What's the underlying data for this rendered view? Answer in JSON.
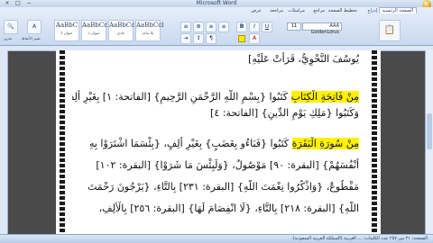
{
  "window": {
    "title": "Microsoft Word",
    "doc_title": "المتخصصة الأولى (مرتبة) - ...",
    "min": "−",
    "max": "□",
    "close": "×"
  },
  "tabs": [
    "الصفحة الرئيسية",
    "إدراج",
    "تخطيط الصفحة",
    "مراجع",
    "مراسلات",
    "مراجعة",
    "عرض"
  ],
  "ribbon": {
    "styles": [
      {
        "preview": "AaBbC",
        "label": "عنوان 1"
      },
      {
        "preview": "AaBbCcI",
        "label": "عنوان 2"
      },
      {
        "preview": "AaBbCcI",
        "label": "عادي"
      },
      {
        "preview": "AaBbCcl",
        "label": "بلا تباعد"
      }
    ],
    "font_size": "11",
    "font_name": "AAA GoldenLotus",
    "change_styles": "تغيير الأنماط",
    "edit": "تحرير"
  },
  "document": {
    "lines": [
      {
        "text": "يُوسُفَ النَّحْوِيُّ، قَرَأَتْ عَلَيْهِ]",
        "hl": ""
      },
      {
        "text": "",
        "hl": ""
      },
      {
        "text": " كَتَبُوا {بِسْمِ اللَّهِ الرَّحْمَنِ الرَّحِيمِ} [الفاتحة: ١] بِغَيْرِ أَلِفٍ.",
        "hl": "مِنْ فَاتِحَةِ الْكِتَابِ"
      },
      {
        "text": "وَكَتَبُوا {مَلِكِ يَوْمِ الدِّينِ} [الفاتحة: ٤]",
        "hl": ""
      },
      {
        "text": "",
        "hl": ""
      },
      {
        "text": " كَتَبُوا {فَبَاءُو بِغَضَبٍ} بِغَيْرِ أَلِفٍ، {بِئْسَمَا اشْتَرَوْا بِهِ",
        "hl": "مِنْ سُورَةِ الْبَقَرَةِ"
      },
      {
        "text": "أَنْفُسَهُمْ} [البقرة: ٩٠] مَوْصُولٌ، {وَلَبِئْسَ مَا شَرَوْا} [البقرة: ١٠٢]",
        "hl": ""
      },
      {
        "text": "مَقْطُوعٌ، {وَاذْكُرُوا نِعْمَتَ اللَّهِ} [البقرة: ٢٣١] بِالتَّاءِ، {يَرْجُونَ رَحْمَتَ",
        "hl": ""
      },
      {
        "text": "اللَّهِ} [البقرة: ٢١٨] بِالتَّاءِ، {لَا انْفِصَامَ لَهَا} [البقرة: ٢٥٦] بِالْأَلِفِ،",
        "hl": ""
      }
    ]
  },
  "status": {
    "left": "الصفحة: ٢١ من ٢٥٧  عدد الكلمات: ...  العربية (المملكة العربية السعودية)",
    "right": ""
  }
}
